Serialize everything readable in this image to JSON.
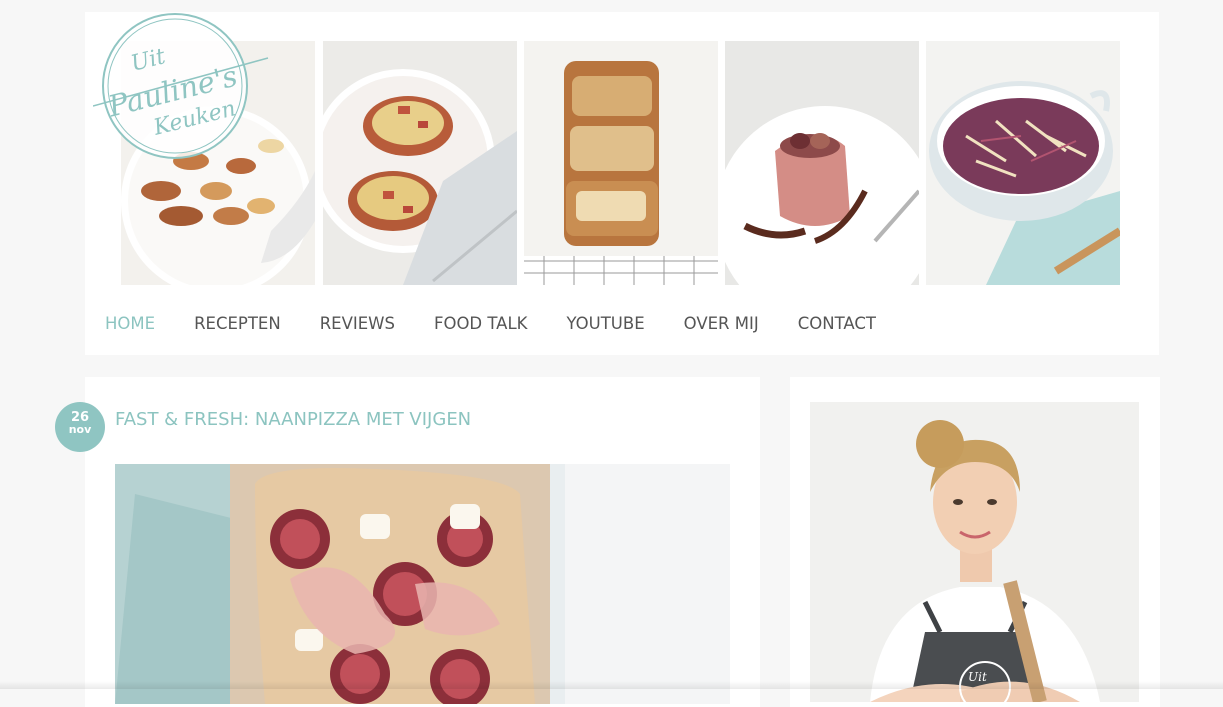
{
  "site": {
    "logo_text": {
      "line1": "Uit",
      "line2": "Pauline's",
      "line3": "Keuken"
    },
    "accent_color": "#8fc5c2"
  },
  "header": {
    "photos": [
      {
        "name": "roasted-potatoes-photo"
      },
      {
        "name": "stuffed-sweet-potato-photo"
      },
      {
        "name": "pull-apart-bread-photo"
      },
      {
        "name": "fig-ham-roll-photo"
      },
      {
        "name": "coleslaw-bowl-photo"
      }
    ]
  },
  "nav": {
    "items": [
      {
        "label": "HOME",
        "active": true
      },
      {
        "label": "RECEPTEN",
        "active": false
      },
      {
        "label": "REVIEWS",
        "active": false
      },
      {
        "label": "FOOD TALK",
        "active": false
      },
      {
        "label": "YOUTUBE",
        "active": false
      },
      {
        "label": "OVER MIJ",
        "active": false
      },
      {
        "label": "CONTACT",
        "active": false
      }
    ]
  },
  "post": {
    "date_day": "26",
    "date_month": "nov",
    "title": "FAST & FRESH: NAANPIZZA MET VIJGEN"
  },
  "sidebar": {
    "photo": "author-portrait-photo",
    "apron_text": "Uit"
  }
}
